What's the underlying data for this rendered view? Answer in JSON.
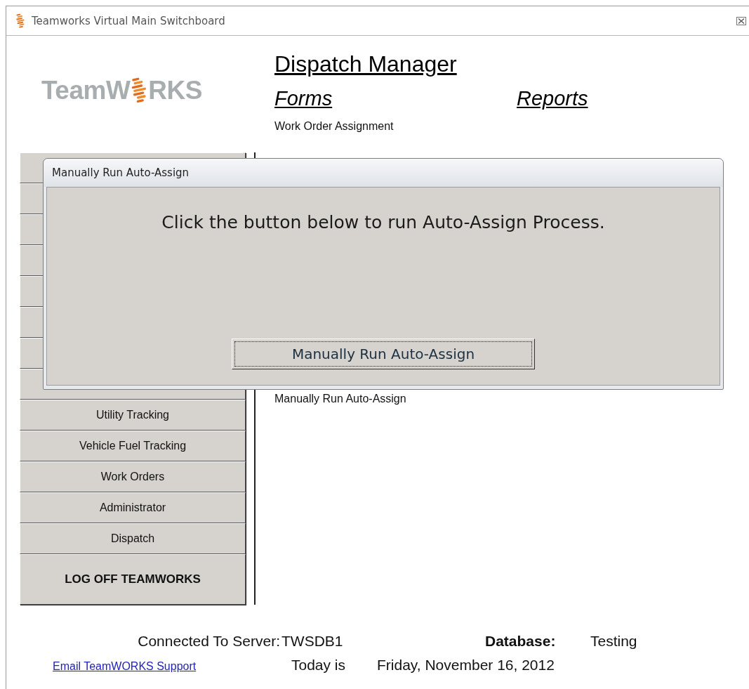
{
  "window": {
    "title": "Teamworks Virtual Main Switchboard"
  },
  "logo": {
    "text_start": "TeamW",
    "text_end": "RKS"
  },
  "heading": "Dispatch Manager",
  "forms": {
    "title": "Forms",
    "items": [
      "Work Order Assignment"
    ]
  },
  "reports": {
    "title": "Reports"
  },
  "sidebar": {
    "items": [
      {
        "kind": "covered"
      },
      {
        "kind": "covered"
      },
      {
        "kind": "covered"
      },
      {
        "kind": "covered"
      },
      {
        "kind": "covered"
      },
      {
        "kind": "covered"
      },
      {
        "kind": "covered"
      },
      {
        "kind": "covered"
      },
      {
        "kind": "button",
        "label": "Utility Tracking"
      },
      {
        "kind": "button",
        "label": "Vehicle Fuel Tracking"
      },
      {
        "kind": "button",
        "label": "Work Orders"
      },
      {
        "kind": "button",
        "label": "Administrator"
      },
      {
        "kind": "button",
        "label": "Dispatch"
      },
      {
        "kind": "logoff",
        "label": "LOG OFF TEAMWORKS"
      }
    ]
  },
  "processes": [
    "Manually Run Auto-Assign"
  ],
  "footer": {
    "server_label": "Connected To Server:",
    "server": "TWSDB1",
    "database_label": "Database:",
    "database": "Testing",
    "email_link": "Email TeamWORKS Support",
    "today_label": "Today is",
    "date": "Friday, November 16, 2012"
  },
  "dialog": {
    "title": "Manually Run Auto-Assign",
    "message": "Click the button below to run Auto-Assign Process.",
    "button": "Manually Run Auto-Assign"
  }
}
